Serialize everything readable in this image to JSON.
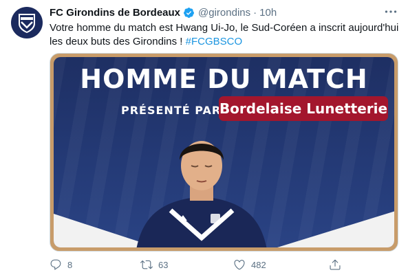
{
  "tweet": {
    "author_name": "FC Girondins de Bordeaux",
    "handle": "@girondins",
    "separator": "·",
    "time": "10h",
    "text_before": "Votre homme du match est Hwang Ui-Jo, le Sud-Coréen a inscrit aujourd'hui les deux buts des Girondins ! ",
    "hashtag": "#FCGBSCO"
  },
  "media": {
    "headline": "HOMME DU MATCH",
    "presented_by": "PRÉSENTÉ PAR",
    "sponsor": "Bordelaise Lunetterie",
    "brand_color": "#a3162d",
    "background_color": "#1e2f63",
    "frame_color": "#c89c6a"
  },
  "actions": {
    "reply_count": "8",
    "retweet_count": "63",
    "like_count": "482"
  },
  "icons": {
    "avatar": "club-crest-icon",
    "verified": "verified-badge-icon",
    "more": "more-options-icon",
    "reply": "reply-icon",
    "retweet": "retweet-icon",
    "like": "heart-icon",
    "share": "share-icon"
  },
  "colors": {
    "link": "#1b95e0",
    "muted": "#5b7083",
    "verified": "#1da1f2"
  }
}
